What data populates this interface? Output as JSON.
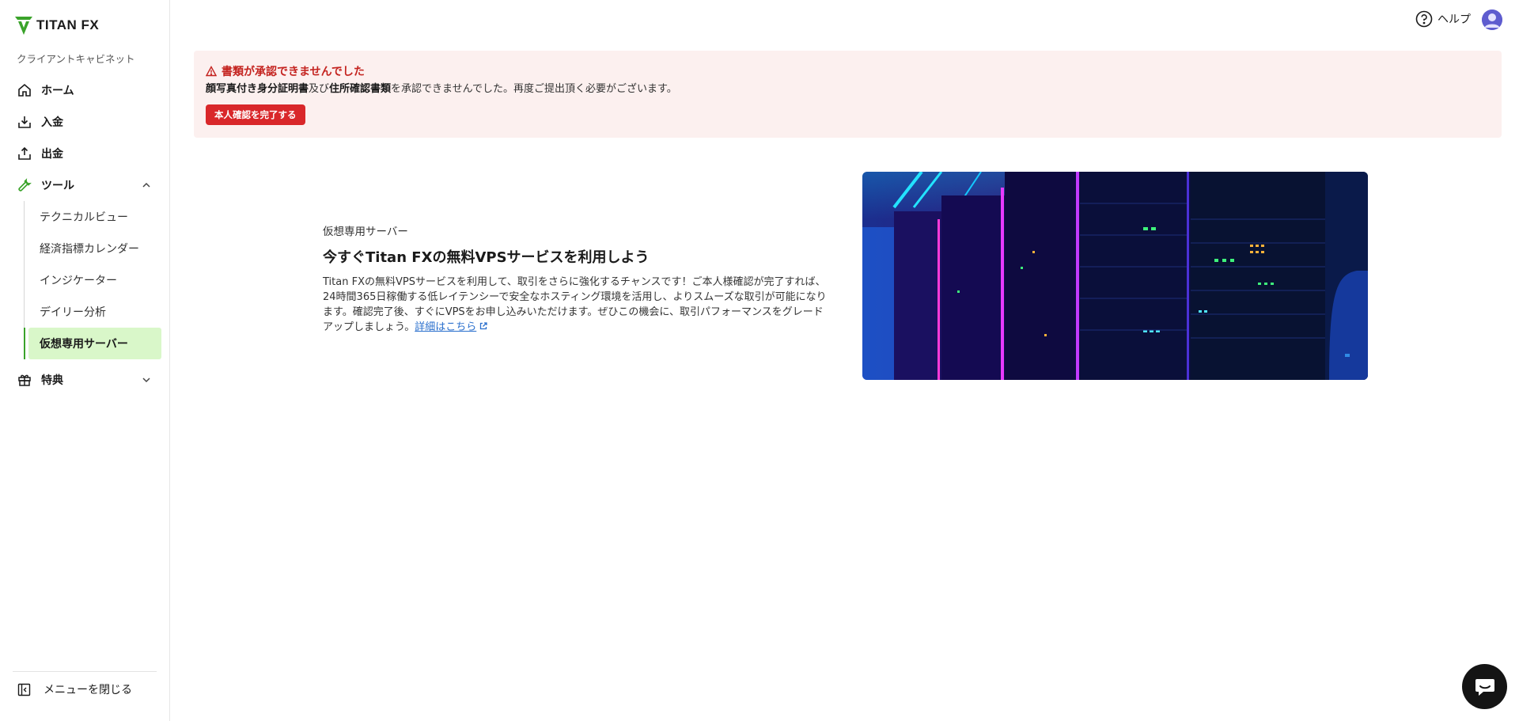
{
  "brand": {
    "logo_text": "TITAN FX"
  },
  "sidebar": {
    "section_label": "クライアントキャビネット",
    "items": [
      {
        "label": "ホーム",
        "icon": "home-icon"
      },
      {
        "label": "入金",
        "icon": "deposit-icon"
      },
      {
        "label": "出金",
        "icon": "withdraw-icon"
      },
      {
        "label": "ツール",
        "icon": "wrench-icon",
        "expanded": true
      },
      {
        "label": "特典",
        "icon": "gift-icon",
        "expanded": false
      }
    ],
    "tools_sub": [
      {
        "label": "テクニカルビュー"
      },
      {
        "label": "経済指標カレンダー"
      },
      {
        "label": "インジケーター"
      },
      {
        "label": "デイリー分析"
      },
      {
        "label": "仮想専用サーバー",
        "active": true
      }
    ],
    "collapse_label": "メニューを閉じる"
  },
  "topbar": {
    "help_label": "ヘルプ"
  },
  "alert": {
    "title": "書類が承認できませんでした",
    "body_bold_1": "顔写真付き身分証明書",
    "body_mid": "及び",
    "body_bold_2": "住所確認書類",
    "body_tail": "を承認できませんでした。再度ご提出頂く必要がございます。",
    "button_label": "本人確認を完了する",
    "color": "#c4231f"
  },
  "promo": {
    "subtitle": "仮想専用サーバー",
    "title": "今すぐTitan FXの無料VPSサービスを利用しよう",
    "description": "Titan FXの無料VPSサービスを利用して、取引をさらに強化するチャンスです！ご本人様確認が完了すれば、24時間365日稼働する低レイテンシーで安全なホスティング環境を活用し、よりスムーズな取引が可能になります。確認完了後、すぐにVPSをお申し込みいただけます。ぜひこの機会に、取引パフォーマンスをグレードアップしましょう。",
    "link_label": "詳細はこちら"
  },
  "colors": {
    "accent_green": "#3aa32a",
    "active_bg": "#d9f7c9",
    "alert_bg": "#fcf0ef",
    "button_red": "#d9272a"
  }
}
